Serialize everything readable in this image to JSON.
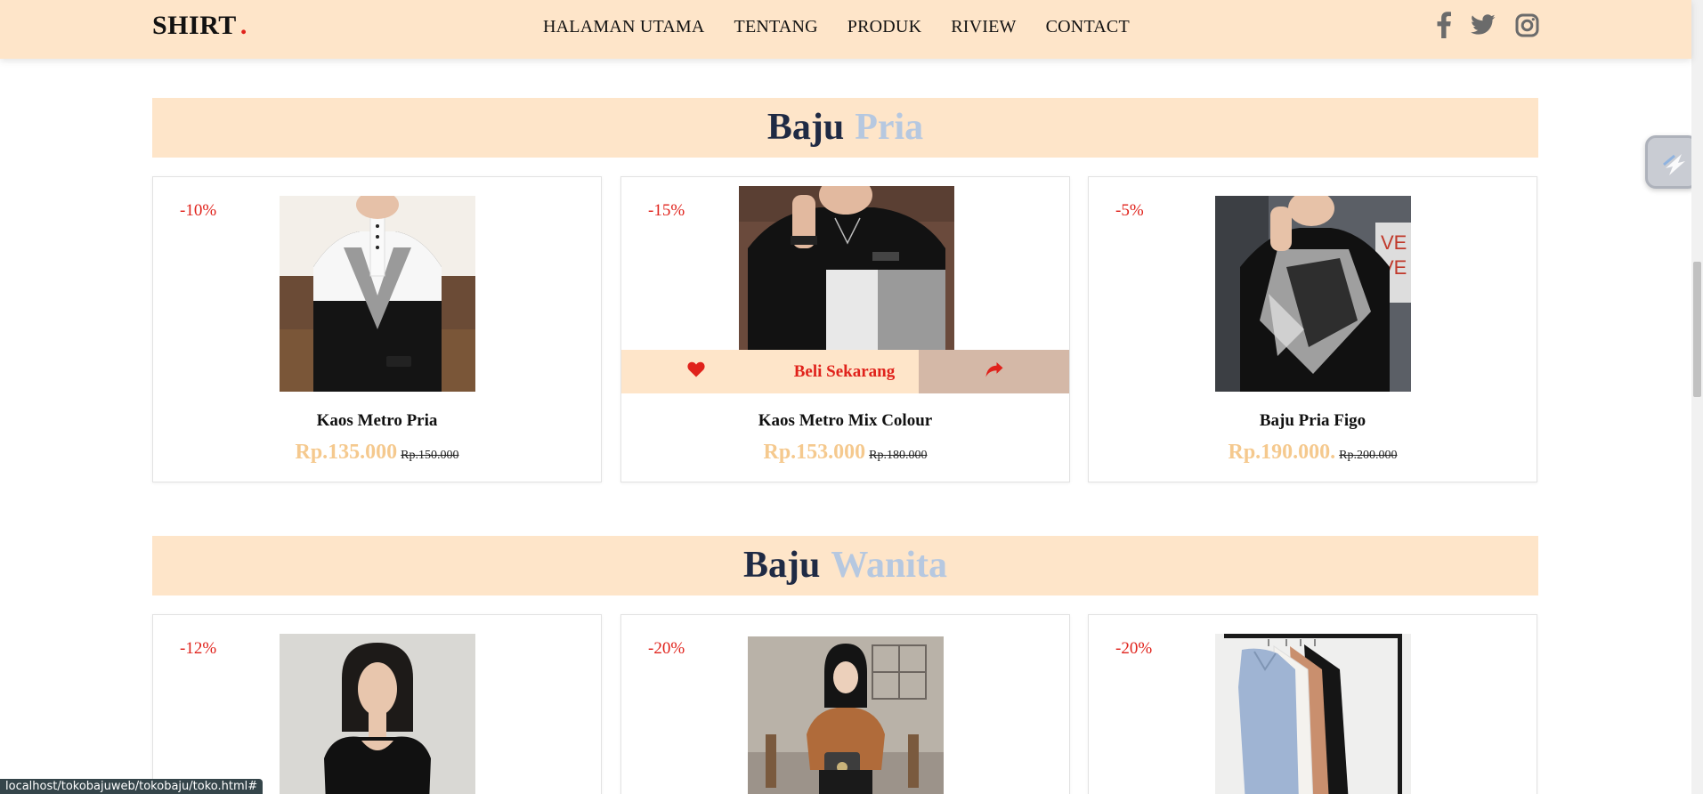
{
  "navbar": {
    "logo": "SHIRT",
    "logo_dot": ".",
    "links": [
      "HALAMAN UTAMA",
      "TENTANG",
      "PRODUK",
      "RIVIEW",
      "CONTACT"
    ],
    "social_icons": [
      "facebook-icon",
      "twitter-icon",
      "instagram-icon"
    ]
  },
  "sections": [
    {
      "title_main": "Baju",
      "title_accent": "Pria",
      "products": [
        {
          "discount": "-10%",
          "name": "Kaos Metro Pria",
          "price": "Rp.135.000",
          "old_price": "Rp.150.000"
        },
        {
          "discount": "-15%",
          "name": "Kaos Metro Mix Colour",
          "price": "Rp.153.000",
          "old_price": "Rp.180.000",
          "buy_label": "Beli Sekarang"
        },
        {
          "discount": "-5%",
          "name": "Baju Pria Figo",
          "price": "Rp.190.000.",
          "old_price": "Rp.200.000"
        }
      ]
    },
    {
      "title_main": "Baju",
      "title_accent": "Wanita",
      "products": [
        {
          "discount": "-12%"
        },
        {
          "discount": "-20%"
        },
        {
          "discount": "-20%"
        }
      ]
    }
  ],
  "status_bar": "localhost/tokobajuweb/tokobaju/toko.html#",
  "colors": {
    "nav_bg": "#fee5c9",
    "accent_red": "#e0221b",
    "price": "#f5c98e",
    "heading_dark": "#1f2a44",
    "heading_accent": "#b6c8e0",
    "share_bg": "#d4b8a7"
  }
}
